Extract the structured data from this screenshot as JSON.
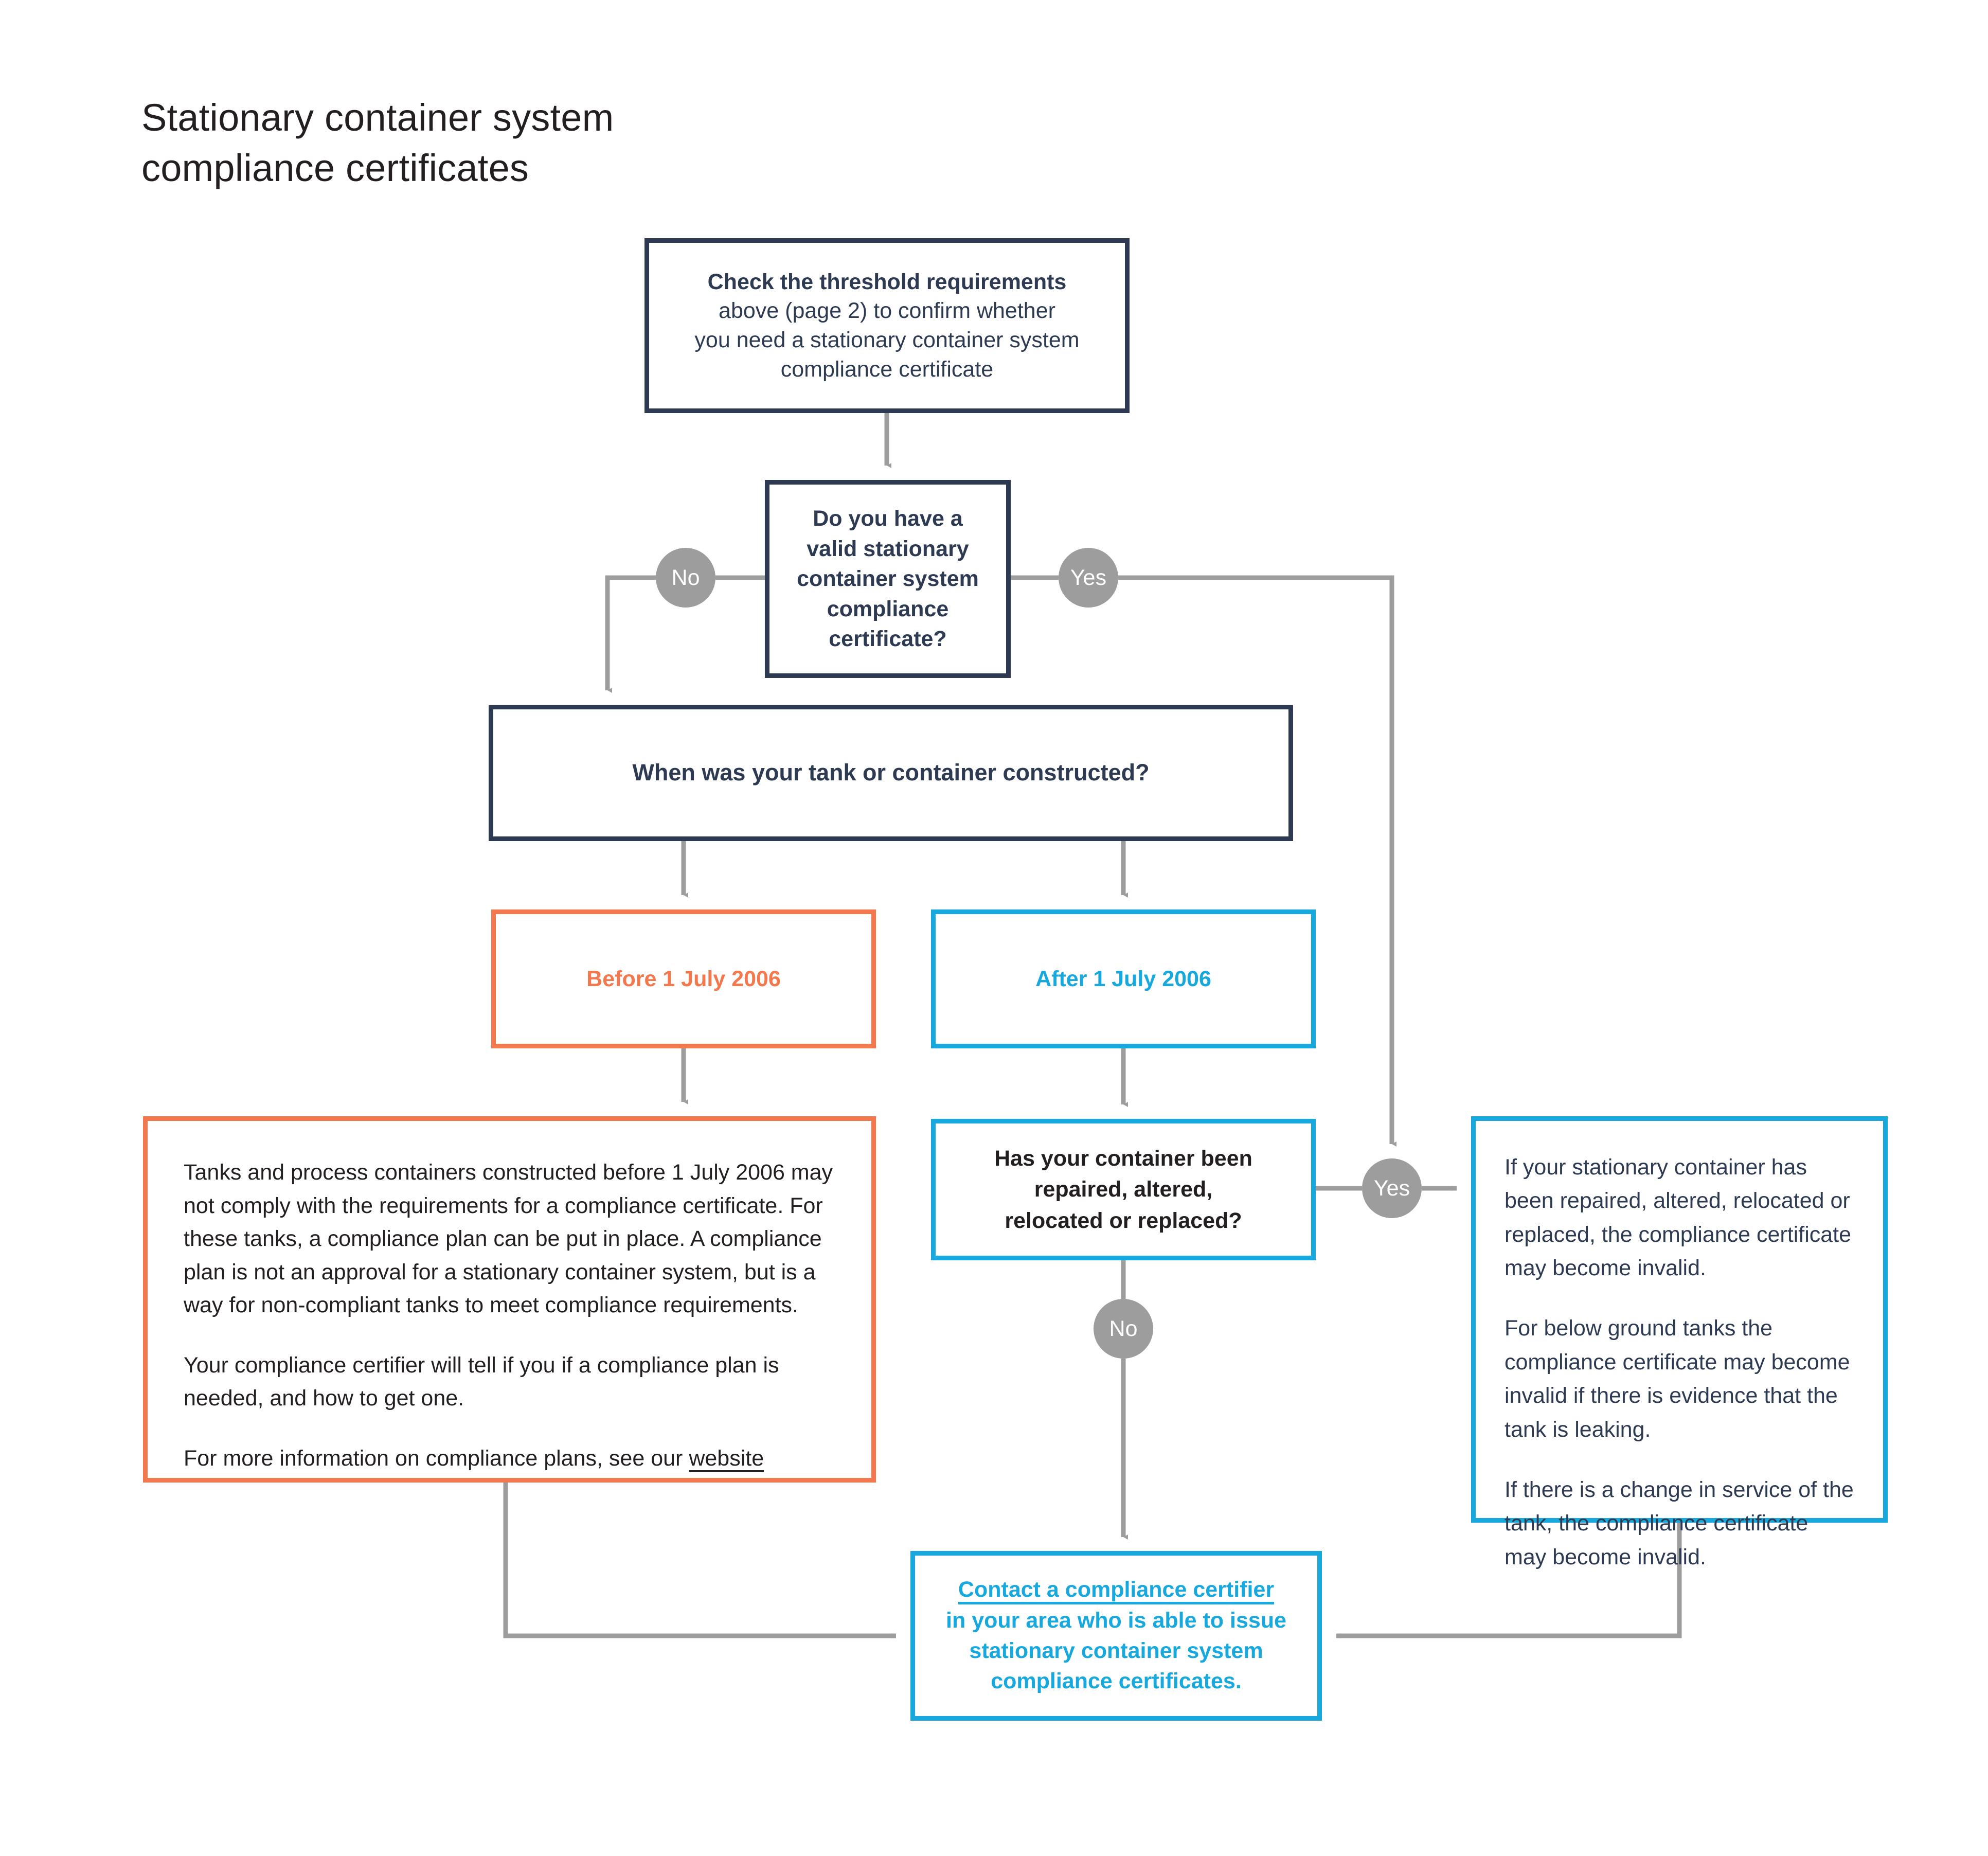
{
  "page": {
    "title": "Stationary container system\ncompliance certificates",
    "background_color": "#ffffff"
  },
  "colors": {
    "navy": "#2e3a52",
    "orange": "#f4784e",
    "blue": "#17a8de",
    "connector_gray": "#9d9d9d",
    "body_text": "#231f20"
  },
  "nodes": {
    "threshold": {
      "heading": "Check the threshold requirements",
      "body": "above (page 2) to confirm whether\nyou need a stationary container system\ncompliance certificate"
    },
    "valid_certificate_question": "Do you have a\nvalid stationary\ncontainer system\ncompliance\ncertificate?",
    "when_constructed_question": "When was your tank or container constructed?",
    "before_2006": "Before 1 July 2006",
    "after_2006": "After 1 July 2006",
    "compliance_plan": {
      "paragraph_1": "Tanks and process containers constructed before 1 July 2006 may not comply with the requirements for a compliance certificate. For these tanks, a compliance plan can be put in place. A compliance plan is not an approval for a stationary container system, but is a way for non-compliant tanks to meet compliance requirements.",
      "paragraph_2": "Your compliance certifier will tell if you if a compliance plan is needed, and how to get one.",
      "paragraph_3_prefix": "For more information on compliance plans, see our ",
      "paragraph_3_link": "website"
    },
    "repaired_question": "Has your container been\nrepaired, altered,\nrelocated or replaced?",
    "invalid_info": {
      "paragraph_1": "If your stationary container has been repaired, altered, relocated or replaced, the compliance certificate may become invalid.",
      "paragraph_2": "For below ground tanks the compliance certificate may become invalid if there is evidence that the tank is leaking.",
      "paragraph_3": "If there is a change in service of the tank, the compliance certificate may become invalid."
    },
    "contact_certifier": {
      "link": "Contact a compliance certifier",
      "body": "in your area who is able to issue\nstationary container system\ncompliance certificates."
    }
  },
  "decision_labels": {
    "valid_no": "No",
    "valid_yes": "Yes",
    "repaired_yes": "Yes",
    "repaired_no": "No"
  }
}
